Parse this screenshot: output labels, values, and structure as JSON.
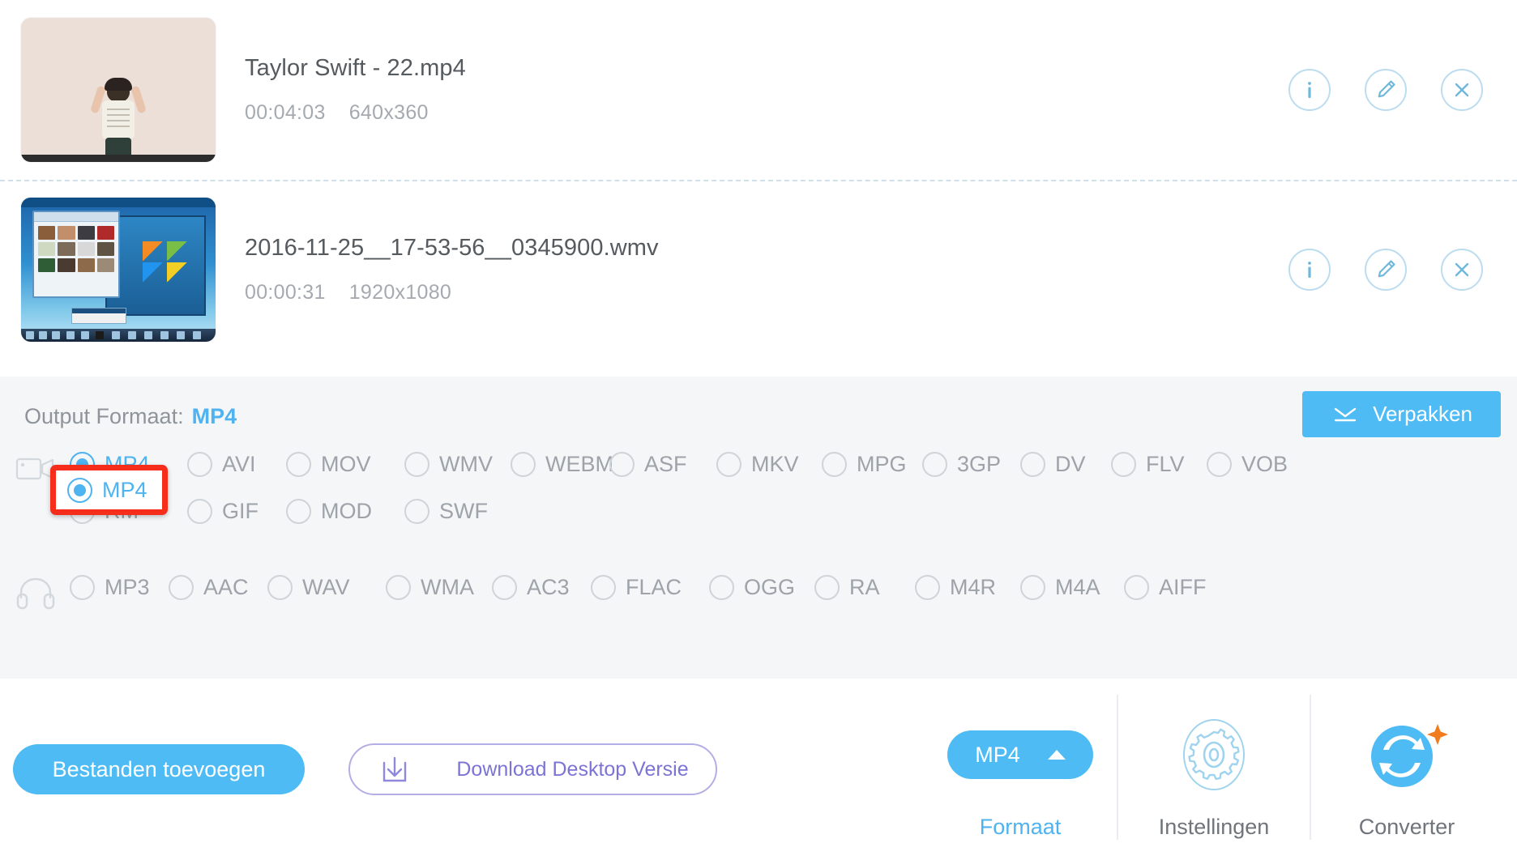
{
  "files": [
    {
      "name": "Taylor Swift - 22.mp4",
      "duration": "00:04:03",
      "resolution": "640x360",
      "thumb_kind": "taylor-swift-video"
    },
    {
      "name": "2016-11-25__17-53-56__0345900.wmv",
      "duration": "00:00:31",
      "resolution": "1920x1080",
      "thumb_kind": "windows-desktop-screen-recording"
    }
  ],
  "row_actions": [
    {
      "icon": "info-icon",
      "name": "info-button"
    },
    {
      "icon": "pencil-icon",
      "name": "edit-button"
    },
    {
      "icon": "close-icon",
      "name": "remove-button"
    }
  ],
  "format_panel": {
    "label": "Output Formaat:",
    "selected_format": "MP4",
    "collapse_button": {
      "label": "Verpakken",
      "icon": "chevron-collapse-icon"
    },
    "video": {
      "icon": "video-camera-icon",
      "rows": [
        [
          "MP4",
          "AVI",
          "MOV",
          "WMV",
          "WEBM",
          "ASF",
          "MKV",
          "MPG",
          "3GP",
          "DV",
          "FLV",
          "VOB"
        ],
        [
          "RM",
          "GIF",
          "MOD",
          "SWF"
        ]
      ]
    },
    "audio": {
      "icon": "headphones-icon",
      "rows": [
        [
          "MP3",
          "AAC",
          "WAV",
          "WMA",
          "AC3",
          "FLAC",
          "OGG",
          "RA",
          "M4R",
          "M4A",
          "AIFF"
        ]
      ]
    },
    "highlight_color": "#f62d1b"
  },
  "bottom_bar": {
    "add_files_label": "Bestanden toevoegen",
    "download_desktop_label": "Download Desktop Versie",
    "download_icon": "download-arrow-icon",
    "tools": [
      {
        "label": "Formaat",
        "value": "MP4",
        "icon": "format-pill",
        "active": true
      },
      {
        "label": "Instellingen",
        "icon": "gear-icon",
        "active": false
      },
      {
        "label": "Converter",
        "icon": "convert-refresh-icon",
        "active": false
      }
    ]
  },
  "colors": {
    "accent": "#4ebbf5",
    "muted_text": "#9da3a9",
    "panel_bg": "#f4f6f8",
    "highlight": "#f62d1b",
    "purple": "#7b74d6",
    "star": "#f07c1e"
  }
}
